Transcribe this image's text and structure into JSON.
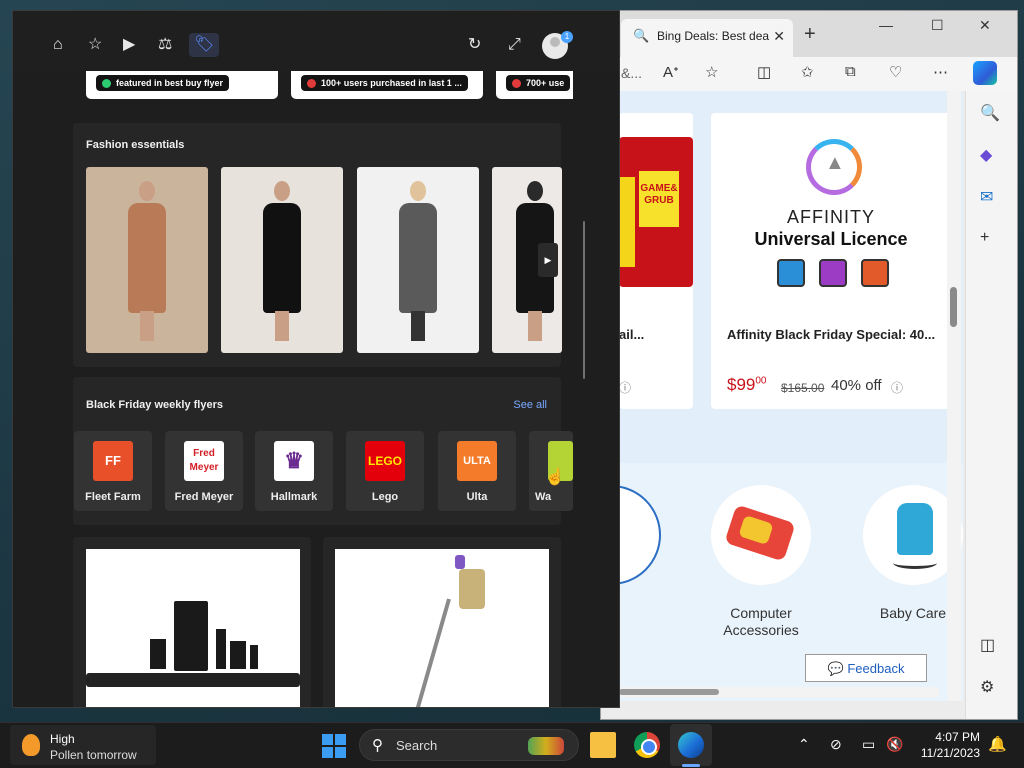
{
  "browser": {
    "tab_title": "Bing Deals: Best dea",
    "address_fragment": "&...",
    "product_left": {
      "title_fragment": "ail...",
      "red_image_text": "GAME& GRUB"
    },
    "product_right": {
      "brand_line": "AFFINITY",
      "subtitle": "Universal Licence",
      "title": "Affinity Black Friday Special: 40...",
      "price_main": "$99",
      "price_cents": "00",
      "old_price": "$165.00",
      "discount": "40% off"
    },
    "categories": [
      {
        "label": "s"
      },
      {
        "label": "Computer Accessories"
      },
      {
        "label": "Baby Care"
      }
    ],
    "feedback_label": "Feedback"
  },
  "panel": {
    "badges": [
      {
        "text": "featured in best buy flyer",
        "dot_color": "#2ecc71"
      },
      {
        "text": "100+ users purchased in last 1 ...",
        "dot_color": "#e03a3a"
      },
      {
        "text": "700+ use",
        "dot_color": "#e03a3a"
      }
    ],
    "fashion": {
      "title": "Fashion essentials",
      "items": [
        {
          "bg": "#cbb49c",
          "dress": "#b97a57"
        },
        {
          "bg": "#e7e2db",
          "dress": "#111111"
        },
        {
          "bg": "#f1f1f1",
          "dress": "#5a5a5a"
        },
        {
          "bg": "#ece9e6",
          "dress": "#151515"
        }
      ]
    },
    "flyers": {
      "title": "Black Friday weekly flyers",
      "see_all": "See all",
      "items": [
        {
          "name": "Fleet Farm",
          "logo_text": "FF",
          "logo_bg": "#e8502a",
          "logo_fg": "#ffffff"
        },
        {
          "name": "Fred Meyer",
          "logo_text": "Fred Meyer",
          "logo_bg": "#ffffff",
          "logo_fg": "#d32027"
        },
        {
          "name": "Hallmark",
          "logo_text": "♛",
          "logo_bg": "#ffffff",
          "logo_fg": "#6a2c91"
        },
        {
          "name": "Lego",
          "logo_text": "LEGO",
          "logo_bg": "#e3000b",
          "logo_fg": "#ffe600"
        },
        {
          "name": "Ulta",
          "logo_text": "ULTA",
          "logo_bg": "#f47b2a",
          "logo_fg": "#ffffff"
        },
        {
          "name": "Wa",
          "logo_text": "",
          "logo_bg": "#b4d335",
          "logo_fg": "#ffffff"
        }
      ]
    }
  },
  "taskbar": {
    "weather_title": "High",
    "weather_sub": "Pollen tomorrow",
    "search_label": "Search",
    "time": "4:07 PM",
    "date": "11/21/2023"
  }
}
